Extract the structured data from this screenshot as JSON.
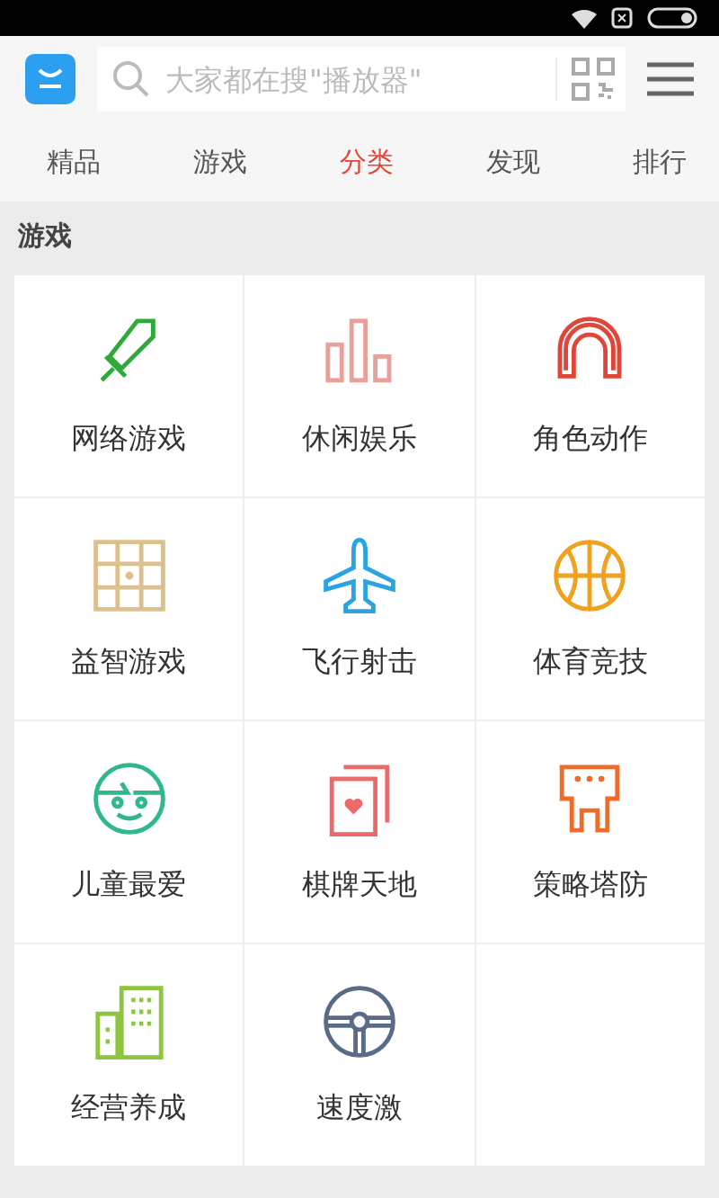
{
  "search": {
    "placeholder": "大家都在搜\"播放器\""
  },
  "tabs": [
    {
      "label": "精品",
      "selected": false
    },
    {
      "label": "游戏",
      "selected": false
    },
    {
      "label": "分类",
      "selected": true
    },
    {
      "label": "发现",
      "selected": false
    },
    {
      "label": "排行",
      "selected": false
    }
  ],
  "section": {
    "title": "游戏"
  },
  "categories": [
    {
      "label": "网络游戏",
      "kind": "sword",
      "color": "#2eaa3a"
    },
    {
      "label": "休闲娱乐",
      "kind": "bars",
      "color": "#e8a09a"
    },
    {
      "label": "角色动作",
      "kind": "arch",
      "color": "#e0453a"
    },
    {
      "label": "益智游戏",
      "kind": "puzzle",
      "color": "#dcc08e"
    },
    {
      "label": "飞行射击",
      "kind": "plane",
      "color": "#2aa3e0"
    },
    {
      "label": "体育竞技",
      "kind": "ball",
      "color": "#f0a21e"
    },
    {
      "label": "儿童最爱",
      "kind": "face",
      "color": "#2fb88a"
    },
    {
      "label": "棋牌天地",
      "kind": "cards",
      "color": "#ec6a6a"
    },
    {
      "label": "策略塔防",
      "kind": "tower",
      "color": "#ee6b2a"
    },
    {
      "label": "经营养成",
      "kind": "building",
      "color": "#8cc63e"
    },
    {
      "label": "速度激",
      "kind": "wheel",
      "color": "#5a6b86"
    }
  ]
}
